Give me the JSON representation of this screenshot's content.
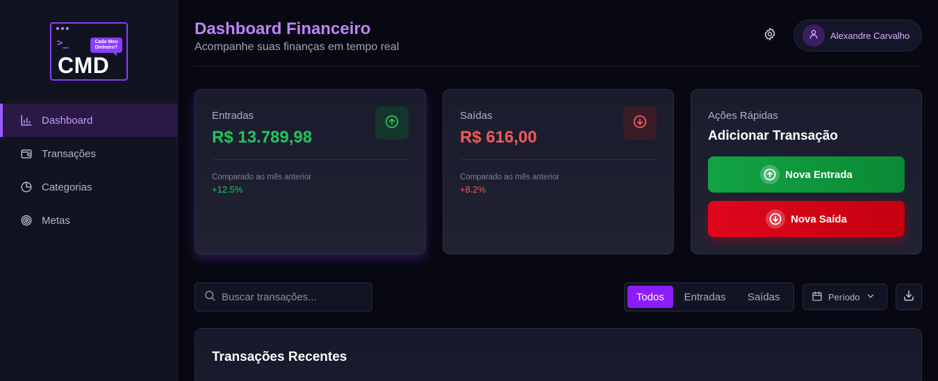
{
  "logo": {
    "bubble_line1": "Cade Meu",
    "bubble_line2": "Dinheiro?",
    "word": "CMD",
    "prompt": ">_"
  },
  "sidebar": {
    "items": [
      {
        "label": "Dashboard",
        "icon": "bar-chart-icon",
        "active": true
      },
      {
        "label": "Transações",
        "icon": "wallet-icon",
        "active": false
      },
      {
        "label": "Categorias",
        "icon": "pie-chart-icon",
        "active": false
      },
      {
        "label": "Metas",
        "icon": "target-icon",
        "active": false
      }
    ]
  },
  "header": {
    "title": "Dashboard Financeiro",
    "subtitle": "Acompanhe suas finanças em tempo real",
    "user_name": "Alexandre Carvalho"
  },
  "cards": {
    "income": {
      "label": "Entradas",
      "value": "R$ 13.789,98",
      "note": "Comparado ao mês anterior",
      "delta": "+12.5%"
    },
    "expense": {
      "label": "Saídas",
      "value": "R$ 616,00",
      "note": "Comparado ao mês anterior",
      "delta": "+8.2%"
    },
    "quick": {
      "label": "Ações Rápidas",
      "title": "Adicionar Transação",
      "income_button": "Nova Entrada",
      "expense_button": "Nova Saída"
    }
  },
  "toolbar": {
    "search_placeholder": "Buscar transações...",
    "filters": [
      "Todos",
      "Entradas",
      "Saídas"
    ],
    "active_filter": "Todos",
    "period_label": "Período"
  },
  "recent": {
    "title": "Transações Recentes"
  },
  "colors": {
    "accent": "#8b1dfc",
    "income": "#22c55e",
    "expense": "#f05a5a",
    "background": "#080812",
    "sidebar": "#121321"
  }
}
